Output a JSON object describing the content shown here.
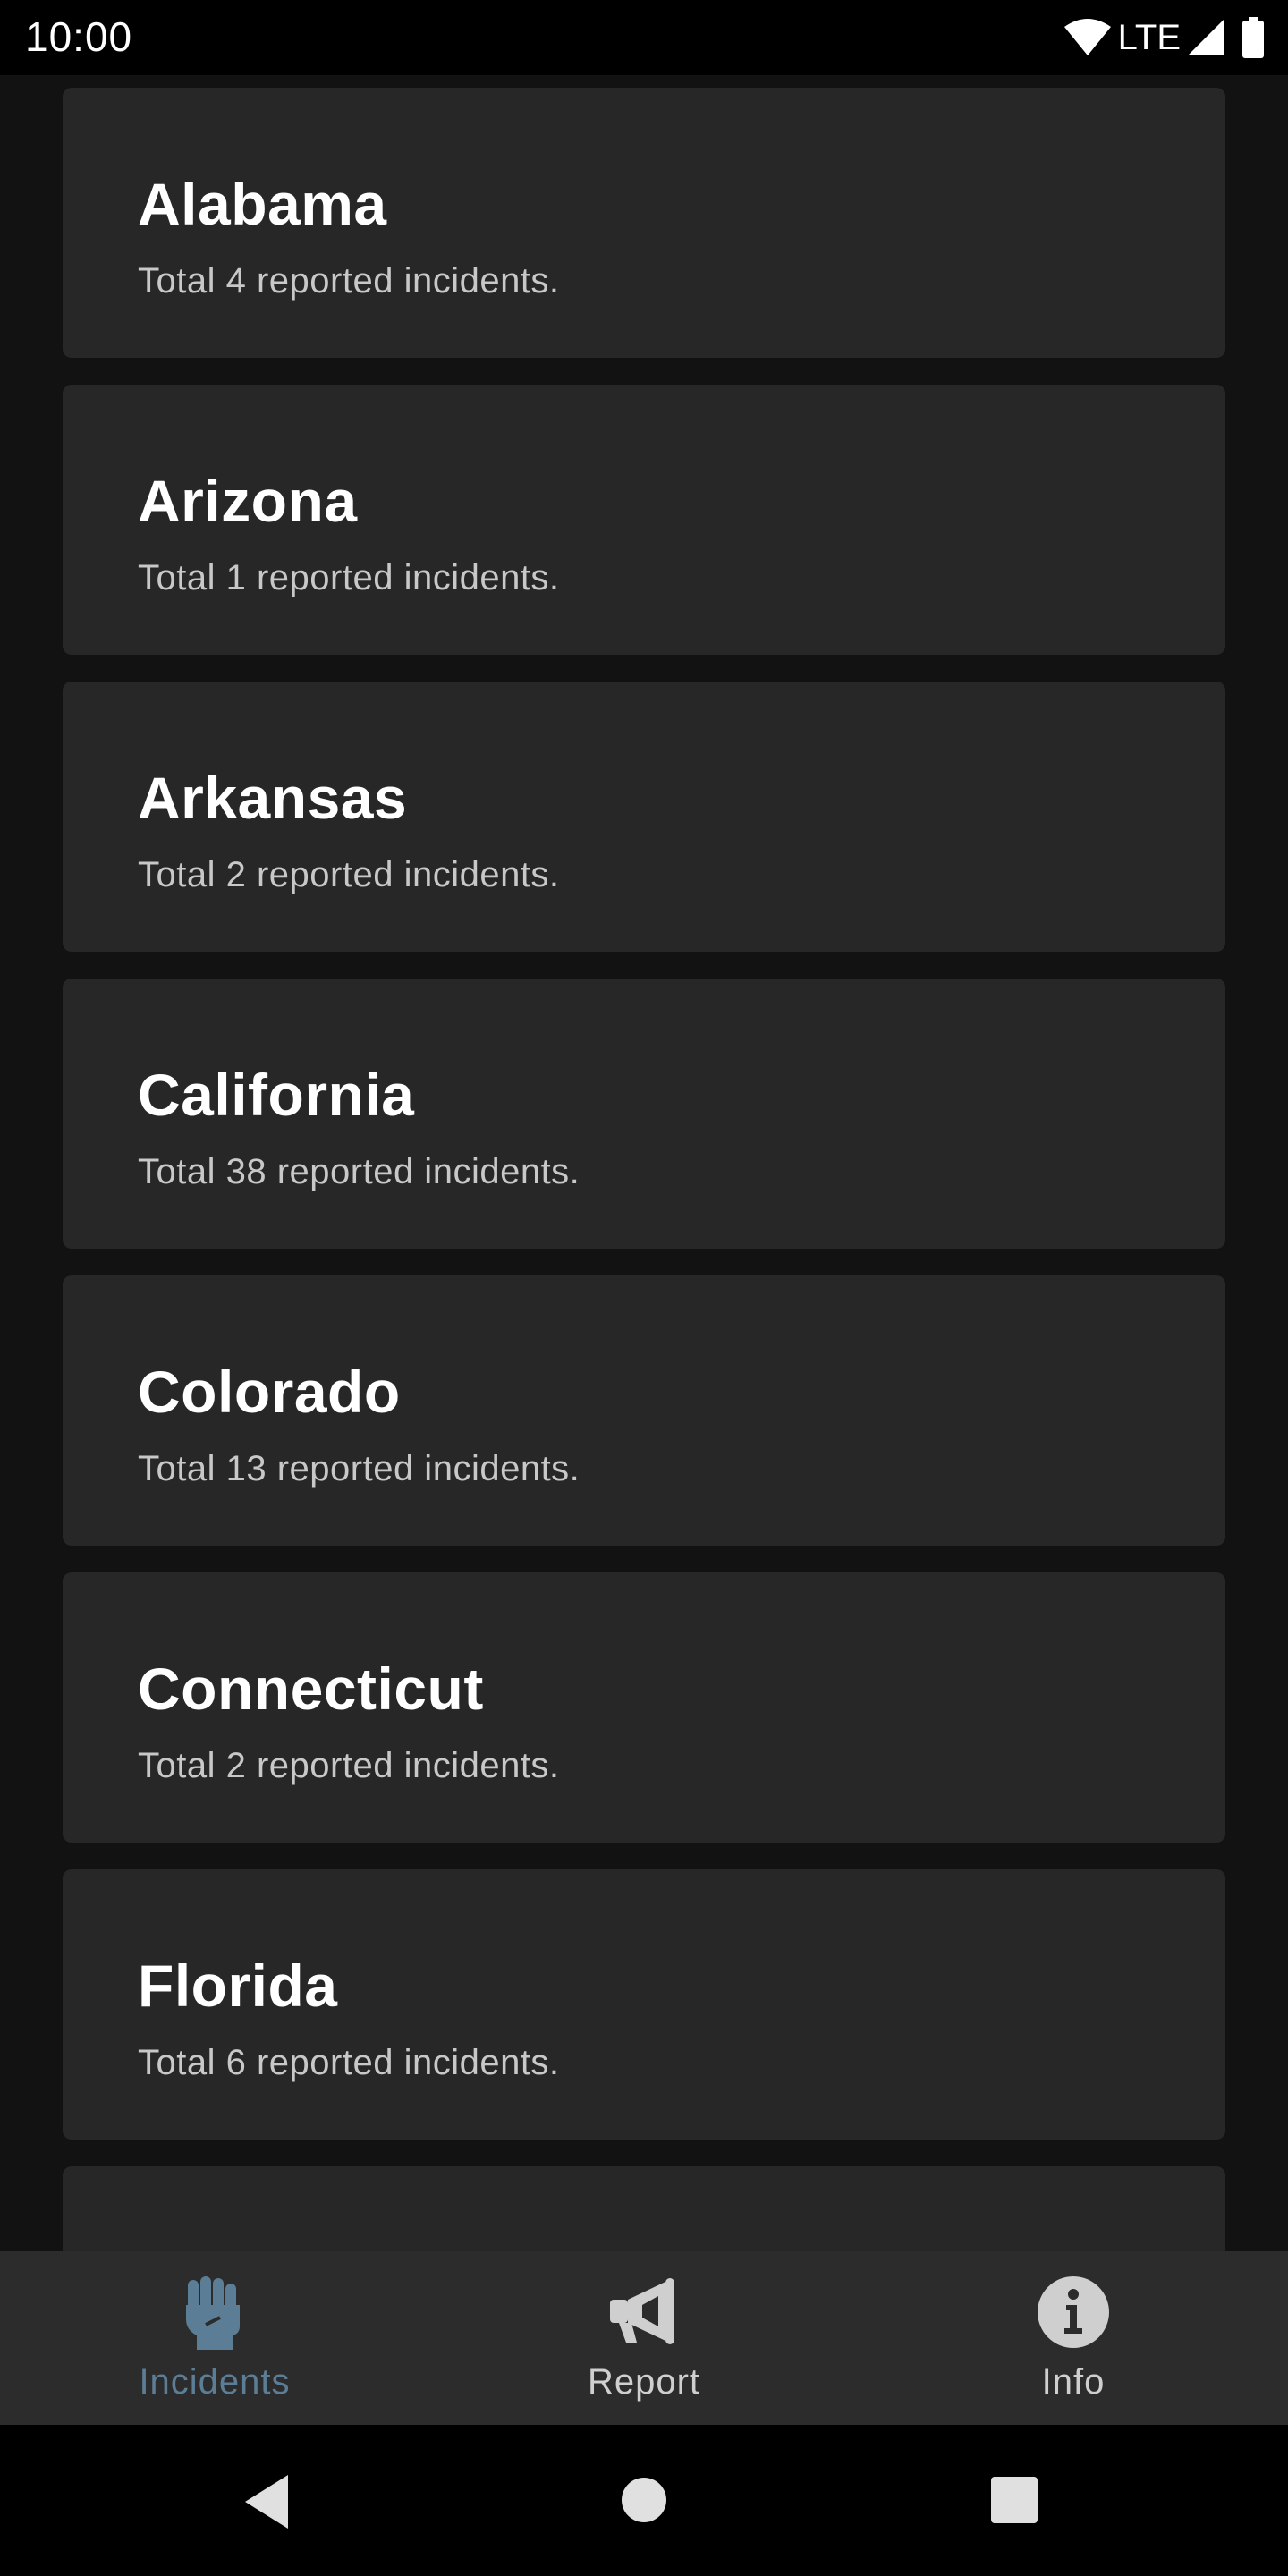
{
  "status_bar": {
    "time": "10:00",
    "network": "LTE",
    "icons": [
      "wifi-icon",
      "signal-icon",
      "battery-icon"
    ]
  },
  "states": [
    {
      "name": "Alabama",
      "summary": "Total 4 reported incidents."
    },
    {
      "name": "Arizona",
      "summary": "Total 1 reported incidents."
    },
    {
      "name": "Arkansas",
      "summary": "Total 2 reported incidents."
    },
    {
      "name": "California",
      "summary": "Total 38 reported incidents."
    },
    {
      "name": "Colorado",
      "summary": "Total 13 reported incidents."
    },
    {
      "name": "Connecticut",
      "summary": "Total 2 reported incidents."
    },
    {
      "name": "Florida",
      "summary": "Total 6 reported incidents."
    }
  ],
  "bottom_nav": {
    "items": [
      {
        "label": "Incidents",
        "icon": "raised-fist-icon",
        "active": true
      },
      {
        "label": "Report",
        "icon": "megaphone-icon",
        "active": false
      },
      {
        "label": "Info",
        "icon": "info-icon",
        "active": false
      }
    ]
  },
  "colors": {
    "background": "#121212",
    "card": "#272727",
    "nav_bar": "#2c2c2c",
    "active": "#5b7d95",
    "inactive": "#cfcfcf"
  },
  "system_nav": [
    "back-icon",
    "home-icon",
    "recents-icon"
  ]
}
